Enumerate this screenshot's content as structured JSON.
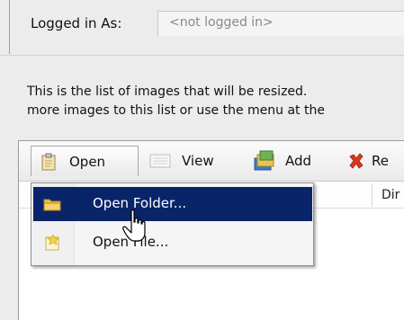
{
  "status": {
    "logged_label": "Logged in As:",
    "logged_value": "<not logged in>"
  },
  "description": {
    "line1": "This is the list of images that will be resized.",
    "line2": "more images to this list or use the menu at the"
  },
  "toolbar": {
    "buttons": [
      {
        "label": "Open",
        "icon": "clipboard-icon"
      },
      {
        "label": "View",
        "icon": "view-icon"
      },
      {
        "label": "Add",
        "icon": "add-images-icon"
      },
      {
        "label": "Re",
        "icon": "remove-x-icon"
      }
    ]
  },
  "columns": {
    "dir_label": "Dir"
  },
  "open_menu": {
    "items": [
      {
        "label": "Open Folder...",
        "icon": "folder-icon",
        "highlighted": true
      },
      {
        "label": "Open File...",
        "icon": "file-open-icon",
        "highlighted": false
      }
    ]
  },
  "colors": {
    "menu_highlight": "#0a246a",
    "remove_icon": "#d9381e",
    "folder_icon": "#e8b63a"
  }
}
